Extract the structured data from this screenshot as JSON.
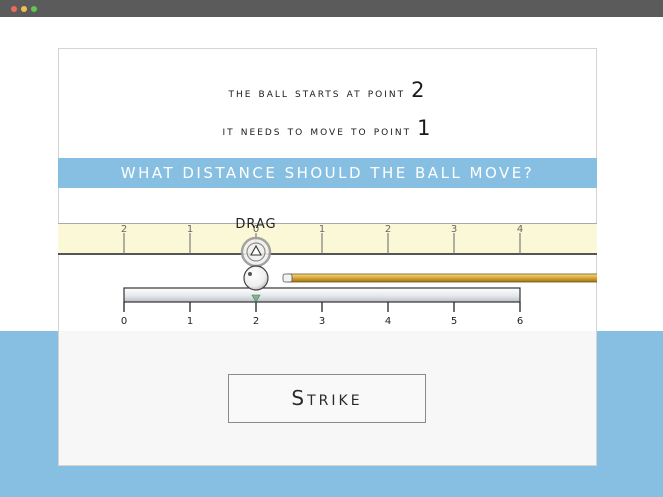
{
  "prompt": {
    "start_text": "the ball starts at point",
    "start_point": "2",
    "target_text": "it needs to move to point",
    "target_point": "1"
  },
  "question": "WHAT DISTANCE SHOULD THE BALL MOVE?",
  "drag_label": "DRAG",
  "top_ruler": {
    "labels": [
      "2",
      "1",
      "0",
      "1",
      "2",
      "3",
      "4"
    ],
    "offset_value": 0
  },
  "bottom_ruler": {
    "labels": [
      "0",
      "1",
      "2",
      "3",
      "4",
      "5",
      "6"
    ]
  },
  "ball": {
    "position": 2
  },
  "strike_label": "Strike",
  "colors": {
    "banner": "#86bfe1",
    "ruler_band": "#fbf8d8",
    "cue_gold": "#d6a531",
    "marker_green": "#7bb68a"
  }
}
